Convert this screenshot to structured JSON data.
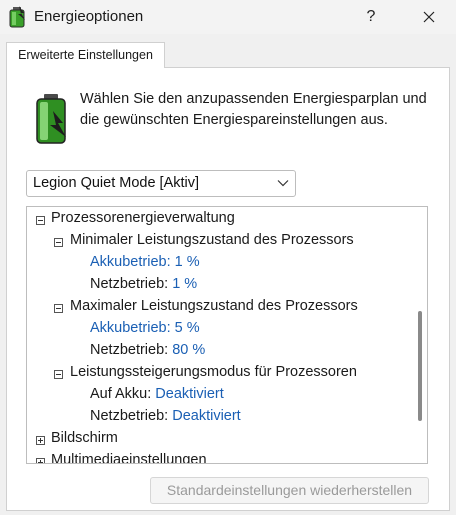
{
  "window": {
    "title": "Energieoptionen",
    "help_label": "?"
  },
  "tab": {
    "label": "Erweiterte Einstellungen"
  },
  "intro": {
    "line1": "Wählen Sie den anzupassenden Energiesparplan und",
    "line2": "die gewünschten Energiespareinstellungen aus."
  },
  "plan_select": {
    "selected": "Legion Quiet Mode [Aktiv]"
  },
  "tree": {
    "group_processor": "Prozessorenergieverwaltung",
    "min_state": {
      "label": "Minimaler Leistungszustand des Prozessors",
      "battery_label": "Akkubetrieb:",
      "battery_value": "1 %",
      "ac_label": "Netzbetrieb:",
      "ac_value": "1 %"
    },
    "max_state": {
      "label": "Maximaler Leistungszustand des Prozessors",
      "battery_label": "Akkubetrieb:",
      "battery_value": "5 %",
      "ac_label": "Netzbetrieb:",
      "ac_value": "80 %"
    },
    "boost_mode": {
      "label": "Leistungssteigerungsmodus für Prozessoren",
      "battery_label": "Auf Akku:",
      "battery_value": "Deaktiviert",
      "ac_label": "Netzbetrieb:",
      "ac_value": "Deaktiviert"
    },
    "group_display": "Bildschirm",
    "group_multimedia": "Multimediaeinstellungen"
  },
  "buttons": {
    "restore_label": "Standardeinstellungen wiederherstellen"
  },
  "colors": {
    "link": "#1a5fb4",
    "accent_green": "#3aa02a"
  }
}
